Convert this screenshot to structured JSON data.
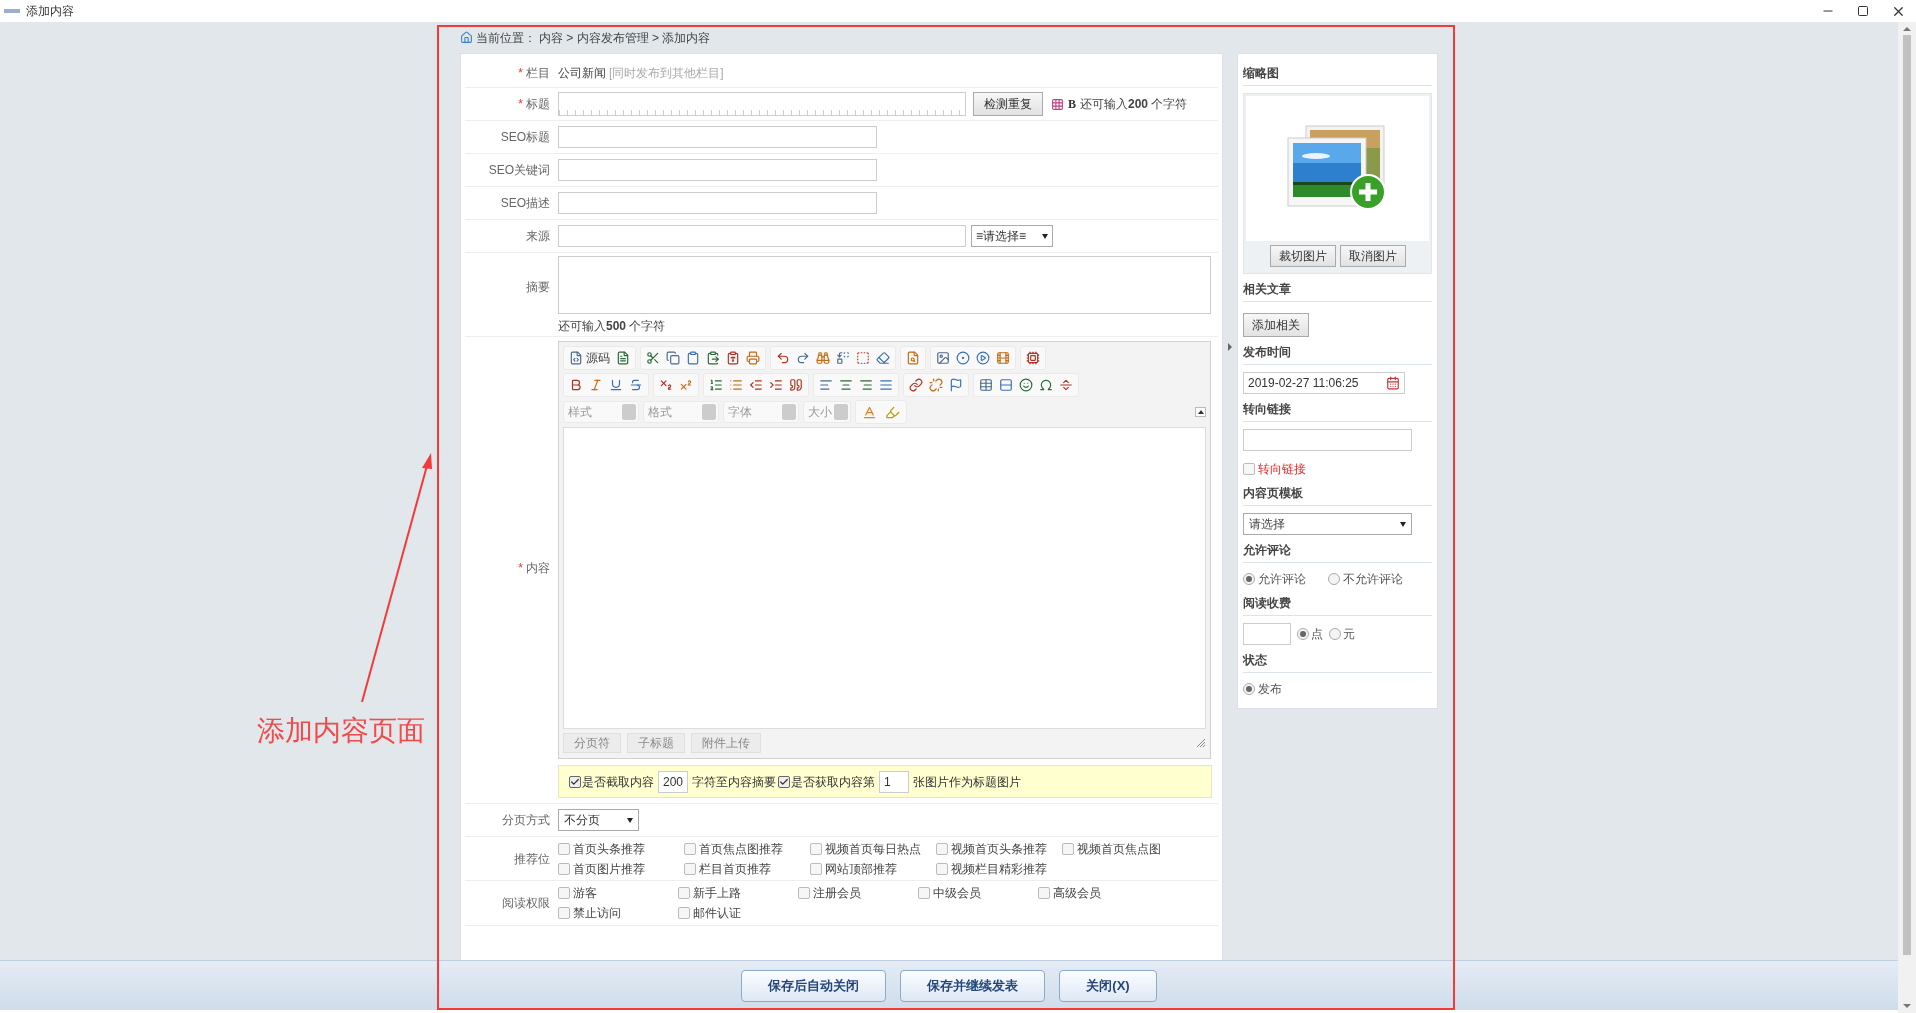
{
  "window": {
    "title": "添加内容"
  },
  "breadcrumb": {
    "label": "当前位置：",
    "path": "内容 > 内容发布管理 > 添加内容"
  },
  "form": {
    "category": {
      "mark": "*",
      "label": "栏目",
      "value": "公司新闻",
      "link": "[同时发布到其他栏目]"
    },
    "title": {
      "mark": "*",
      "label": "标题",
      "check_button": "检测重复",
      "bold_toggle": "B",
      "remaining": "还可输入**200** 个字符"
    },
    "seo_fields": [
      {
        "label": "SEO标题"
      },
      {
        "label": "SEO关键词"
      },
      {
        "label": "SEO描述"
      }
    ],
    "source": {
      "label": "来源",
      "select": "≡请选择≡"
    },
    "summary": {
      "label": "摘要",
      "remaining": "还可输入**500** 个字符"
    },
    "content": {
      "mark": "*",
      "label": "内容",
      "source_label": "源码",
      "combos": [
        "样式",
        "格式",
        "字体",
        "大小"
      ],
      "bottom_buttons": [
        "分页符",
        "子标题",
        "附件上传"
      ]
    },
    "options_bar": [
      {
        "kind": "check",
        "label": "是否截取内容",
        "checked": true
      },
      {
        "kind": "input",
        "value": "200"
      },
      {
        "kind": "text",
        "text": "字符至内容摘要"
      },
      {
        "kind": "check",
        "label": "是否获取内容第",
        "checked": true
      },
      {
        "kind": "input",
        "value": "1"
      },
      {
        "kind": "text",
        "text": "张图片作为标题图片"
      }
    ],
    "pagination": {
      "label": "分页方式",
      "select": "不分页"
    },
    "recommend": {
      "label": "推荐位",
      "options": [
        {
          "label": "首页头条推荐",
          "checked": false
        },
        {
          "label": "首页焦点图推荐",
          "checked": false
        },
        {
          "label": "视频首页每日热点",
          "checked": false
        },
        {
          "label": "视频首页头条推荐",
          "checked": false
        },
        {
          "label": "视频首页焦点图",
          "checked": false
        },
        {
          "label": "首页图片推荐",
          "checked": false
        },
        {
          "label": "栏目首页推荐",
          "checked": false
        },
        {
          "label": "网站顶部推荐",
          "checked": false
        },
        {
          "label": "视频栏目精彩推荐",
          "checked": false
        }
      ]
    },
    "read_permission": {
      "label": "阅读权限",
      "options": [
        {
          "label": "游客",
          "checked": false
        },
        {
          "label": "新手上路",
          "checked": false
        },
        {
          "label": "注册会员",
          "checked": false
        },
        {
          "label": "中级会员",
          "checked": false
        },
        {
          "label": "高级会员",
          "checked": false
        },
        {
          "label": "禁止访问",
          "checked": false
        },
        {
          "label": "邮件认证",
          "checked": false
        }
      ]
    }
  },
  "sidebar": {
    "thumbnail": {
      "heading": "缩略图",
      "buttons": [
        "裁切图片",
        "取消图片"
      ]
    },
    "related": {
      "heading": "相关文章",
      "button": "添加相关"
    },
    "publish_time": {
      "heading": "发布时间",
      "value": "2019-02-27 11:06:25"
    },
    "redirect": {
      "heading": "转向链接",
      "checkbox_label": "转向链接",
      "checked": false
    },
    "template": {
      "heading": "内容页模板",
      "select": "请选择"
    },
    "comments": {
      "heading": "允许评论",
      "options": [
        {
          "label": "允许评论",
          "selected": true
        },
        {
          "label": "不允许评论",
          "selected": false
        }
      ]
    },
    "fee": {
      "heading": "阅读收费",
      "options": [
        {
          "label": "点",
          "selected": true
        },
        {
          "label": "元",
          "selected": false
        }
      ]
    },
    "status": {
      "heading": "状态",
      "options": [
        {
          "label": "发布",
          "selected": true
        }
      ]
    }
  },
  "footer": {
    "buttons": [
      "保存后自动关闭",
      "保存并继续发表",
      "关闭(X)"
    ]
  },
  "annotation": {
    "text": "添加内容页面"
  }
}
